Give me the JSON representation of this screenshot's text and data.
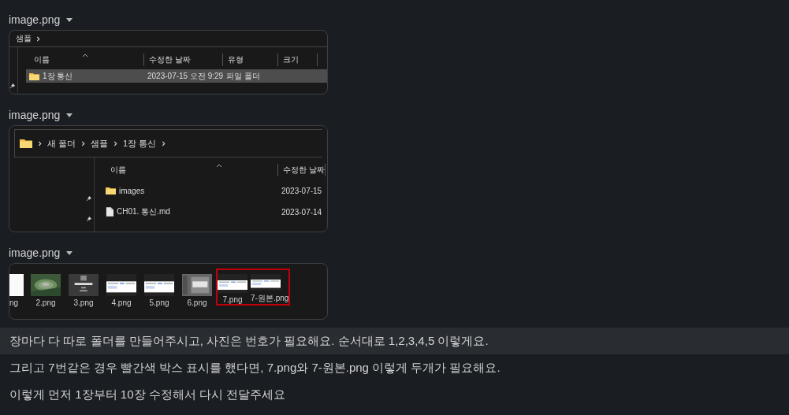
{
  "attachments": [
    {
      "title": "image.png",
      "kind": "explorer",
      "breadcrumb": [
        "샘플"
      ],
      "columns": [
        "이름",
        "수정한 날짜",
        "유형",
        "크기"
      ],
      "rows": [
        {
          "kind": "folder",
          "name": "1장 통신",
          "date": "2023-07-15 오전 9:29",
          "type": "파일 폴더",
          "selected": true
        }
      ]
    },
    {
      "title": "image.png",
      "kind": "explorer",
      "breadcrumb": [
        "새 폴더",
        "샘플",
        "1장 통신"
      ],
      "columns": [
        "이름",
        "수정한 날짜"
      ],
      "rows": [
        {
          "kind": "folder",
          "name": "images",
          "date": "2023-07-15",
          "selected": false
        },
        {
          "kind": "file",
          "name": "CH01. 통신.md",
          "date": "2023-07-14",
          "selected": false
        }
      ]
    },
    {
      "title": "image.png",
      "kind": "thumbnails",
      "items": [
        {
          "label": "ng",
          "highlighted": false
        },
        {
          "label": "2.png",
          "highlighted": false
        },
        {
          "label": "3.png",
          "highlighted": false
        },
        {
          "label": "4.png",
          "highlighted": false
        },
        {
          "label": "5.png",
          "highlighted": false
        },
        {
          "label": "6.png",
          "highlighted": false
        },
        {
          "label": "7.png",
          "highlighted": true
        },
        {
          "label": "7-원본.png",
          "highlighted": true
        }
      ]
    }
  ],
  "messages": [
    {
      "text": "장마다 다 따로 폴더를 만들어주시고, 사진은 번호가 필요해요. 순서대로 1,2,3,4,5 이렇게요.",
      "hovered": true
    },
    {
      "text": "그리고 7번같은 경우 빨간색 박스 표시를 했다면, 7.png와 7-원본.png 이렇게 두개가 필요해요.",
      "hovered": false
    },
    {
      "text": "이렇게 먼저 1장부터 10장 수정해서 다시 전달주세요",
      "hovered": false
    }
  ]
}
